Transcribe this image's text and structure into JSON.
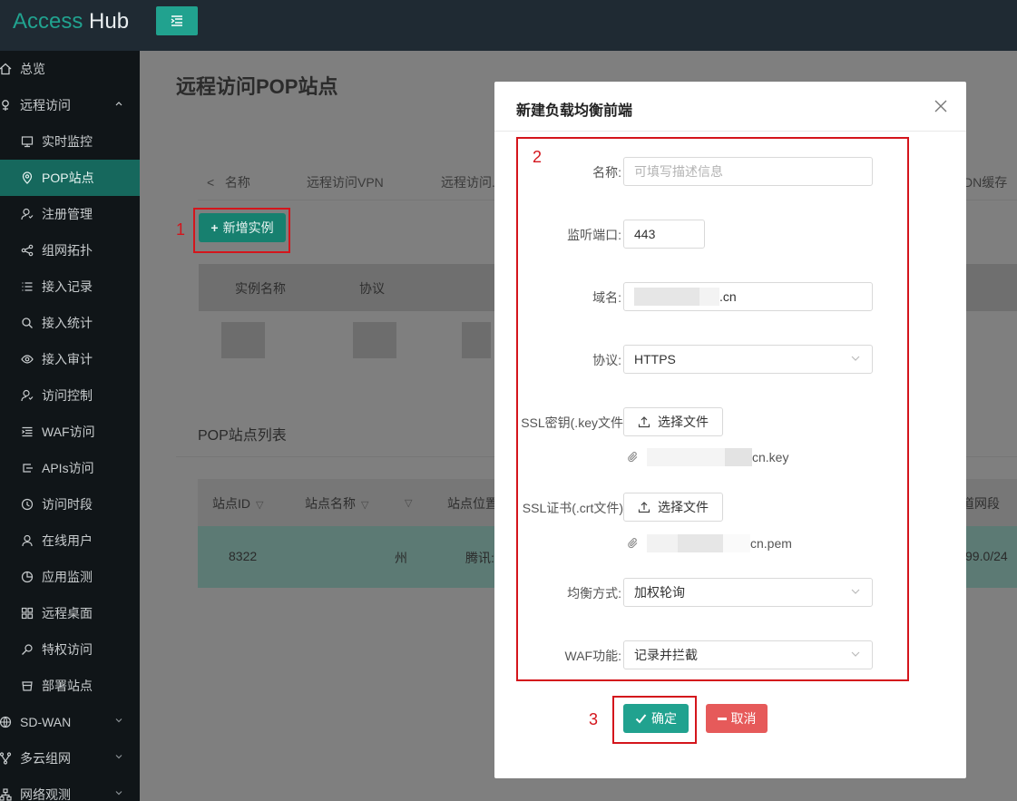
{
  "app": {
    "logo_access": "Access",
    "logo_hub": "Hub"
  },
  "sidebar": {
    "items": [
      {
        "label": "总览",
        "icon": "home-icon"
      },
      {
        "label": "远程访问",
        "icon": "remote-icon"
      },
      {
        "label": "实时监控",
        "icon": "monitor-icon"
      },
      {
        "label": "POP站点",
        "icon": "location-icon"
      },
      {
        "label": "注册管理",
        "icon": "user-register-icon"
      },
      {
        "label": "组网拓扑",
        "icon": "share-icon"
      },
      {
        "label": "接入记录",
        "icon": "list-icon"
      },
      {
        "label": "接入统计",
        "icon": "search-icon"
      },
      {
        "label": "接入审计",
        "icon": "eye-icon"
      },
      {
        "label": "访问控制",
        "icon": "user-control-icon"
      },
      {
        "label": "WAF访问",
        "icon": "waf-icon"
      },
      {
        "label": "APIs访问",
        "icon": "api-icon"
      },
      {
        "label": "访问时段",
        "icon": "clock-icon"
      },
      {
        "label": "在线用户",
        "icon": "user-icon"
      },
      {
        "label": "应用监测",
        "icon": "pie-icon"
      },
      {
        "label": "远程桌面",
        "icon": "grid-icon"
      },
      {
        "label": "特权访问",
        "icon": "key-icon"
      },
      {
        "label": "部署站点",
        "icon": "box-icon"
      },
      {
        "label": "SD-WAN",
        "icon": "globe-icon"
      },
      {
        "label": "多云组网",
        "icon": "branch-icon"
      },
      {
        "label": "网络观测",
        "icon": "network-icon"
      }
    ]
  },
  "main": {
    "title": "远程访问POP站点",
    "tabs": [
      "名称",
      "远程访问VPN",
      "远程访问.",
      "DN缓存"
    ],
    "add_button": "新增实例",
    "table1": {
      "headers": [
        "实例名称",
        "协议"
      ]
    },
    "list_title": "POP站点列表",
    "table2": {
      "headers": [
        "站点ID",
        "站点名称",
        "站点位置",
        "道网段"
      ],
      "row": {
        "id": "8322",
        "city": "州",
        "provider": "腾讯:",
        "cidr": "99.0/24"
      }
    }
  },
  "annotations": {
    "n1": "1",
    "n2": "2",
    "n3": "3"
  },
  "modal": {
    "title": "新建负载均衡前端",
    "name_label": "名称:",
    "name_placeholder": "可填写描述信息",
    "port_label": "监听端口:",
    "port_value": "443",
    "domain_label": "域名:",
    "domain_suffix": ".cn",
    "protocol_label": "协议:",
    "protocol_value": "HTTPS",
    "ssl_key_label": "SSL密钥(.key文件",
    "ssl_crt_label": "SSL证书(.crt文件)",
    "choose_file": "选择文件",
    "key_file_suffix": "cn.key",
    "crt_file_suffix": "cn.pem",
    "balance_label": "均衡方式:",
    "balance_value": "加权轮询",
    "waf_label": "WAF功能:",
    "waf_value": "记录并拦截",
    "ok": "确定",
    "cancel": "取消"
  }
}
